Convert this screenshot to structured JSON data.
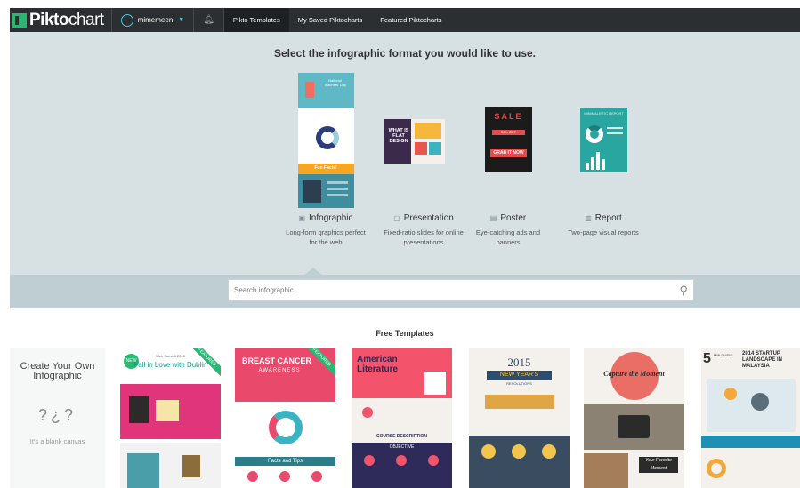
{
  "brand": {
    "logo_bold": "Pikto",
    "logo_thin": "chart"
  },
  "user": {
    "name": "mimemeen"
  },
  "nav": {
    "tabs": [
      {
        "label": "Pikto Templates"
      },
      {
        "label": "My Saved Piktocharts"
      },
      {
        "label": "Featured Piktocharts"
      }
    ]
  },
  "formats": {
    "heading": "Select the infographic format you would like to use.",
    "items": [
      {
        "name": "Infographic",
        "desc": "Long-form graphics perfect for the web",
        "icon": "infographic-icon"
      },
      {
        "name": "Presentation",
        "desc": "Fixed-ratio slides for online presentations",
        "icon": "presentation-icon"
      },
      {
        "name": "Poster",
        "desc": "Eye-catching ads and banners",
        "icon": "poster-icon"
      },
      {
        "name": "Report",
        "desc": "Two-page visual reports",
        "icon": "report-icon"
      }
    ],
    "thumbs": {
      "infographic": {
        "title": "National Teachers' Day",
        "fact": "Fun Facts!"
      },
      "presentation": {
        "title": "WHAT IS FLAT DESIGN"
      },
      "poster": {
        "title": "SALE",
        "off": "30% OFF",
        "cta": "GRAB IT NOW"
      },
      "report": {
        "title": "MINIMALISTIC REPORT"
      }
    }
  },
  "search": {
    "placeholder": "Search infographic"
  },
  "templates": {
    "heading": "Free Templates",
    "blank": {
      "title": "Create Your Own Infographic",
      "note": "It's a blank canvas"
    },
    "cards": [
      {
        "title": "Fall in Love with Dublin",
        "sub": "Web Summit 2015",
        "badge": "FEATURED",
        "new": "NEW"
      },
      {
        "title": "BREAST CANCER",
        "sub": "AWARENESS",
        "badge": "FEATURED",
        "footer": "Facts and Tips"
      },
      {
        "title": "American Literature",
        "section": "COURSE DESCRIPTION",
        "section2": "OBJECTIVE"
      },
      {
        "title": "2015",
        "sub": "NEW YEAR'S",
        "sub2": "RESOLUTIONS"
      },
      {
        "title": "Capture the Moment",
        "sub": "Your Favorite Moment"
      },
      {
        "title": "2014 STARTUP LANDSCAPE IN MALAYSIA",
        "num": "5",
        "sub": "MIN GUIDE:"
      }
    ]
  },
  "colors": {
    "topbar": "#2b2f31",
    "format_bg": "#d7e1e4",
    "search_band": "#bfced3",
    "accent": "#2bb673"
  }
}
